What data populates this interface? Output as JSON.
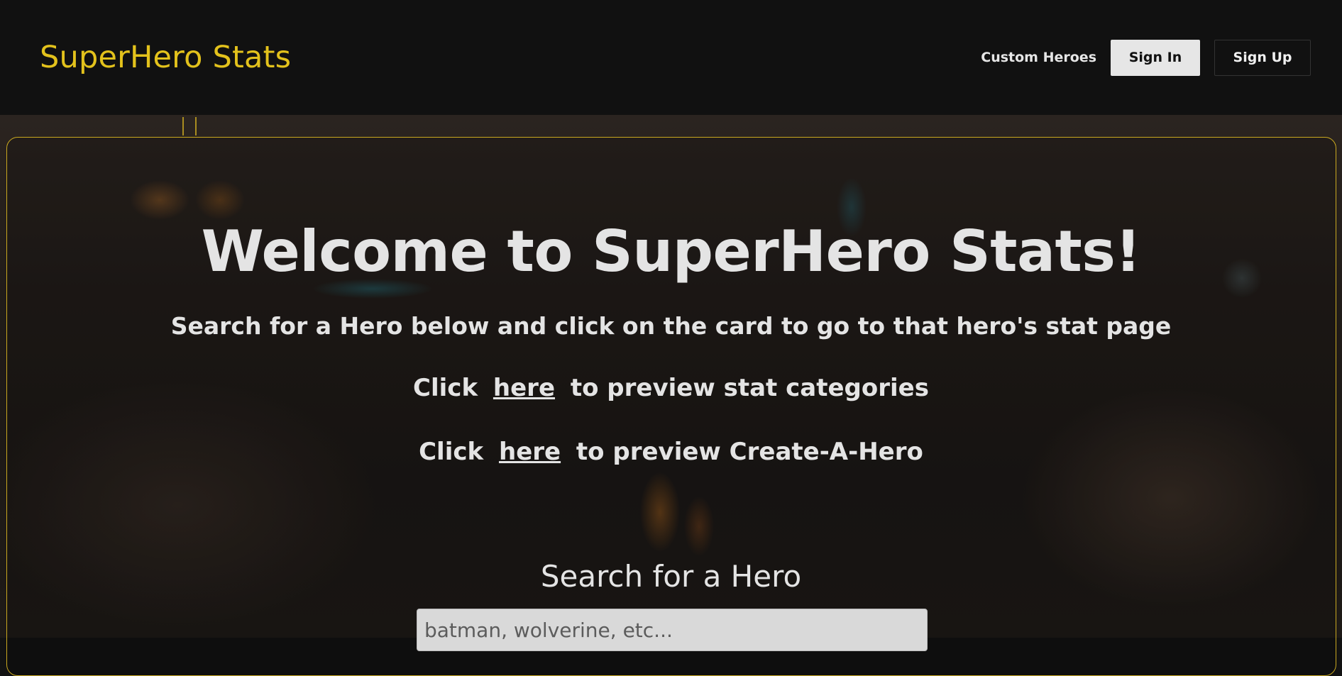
{
  "header": {
    "brand": "SuperHero Stats",
    "nav": {
      "custom_heroes": "Custom Heroes",
      "sign_in": "Sign In",
      "sign_up": "Sign Up"
    }
  },
  "hero": {
    "title": "Welcome to SuperHero Stats!",
    "subtitle": "Search for a Hero below and click on the card to go to that hero's stat page",
    "preview_stats": {
      "prefix": "Click",
      "link": "here",
      "suffix": "to preview stat categories"
    },
    "preview_create": {
      "prefix": "Click",
      "link": "here",
      "suffix": "to preview Create-A-Hero"
    }
  },
  "search": {
    "label": "Search for a Hero",
    "placeholder": "batman, wolverine, etc...",
    "value": ""
  },
  "colors": {
    "brand": "#e3c21c",
    "panel_border": "#c9a820",
    "header_bg": "#111111",
    "text": "#e4e4e4"
  }
}
